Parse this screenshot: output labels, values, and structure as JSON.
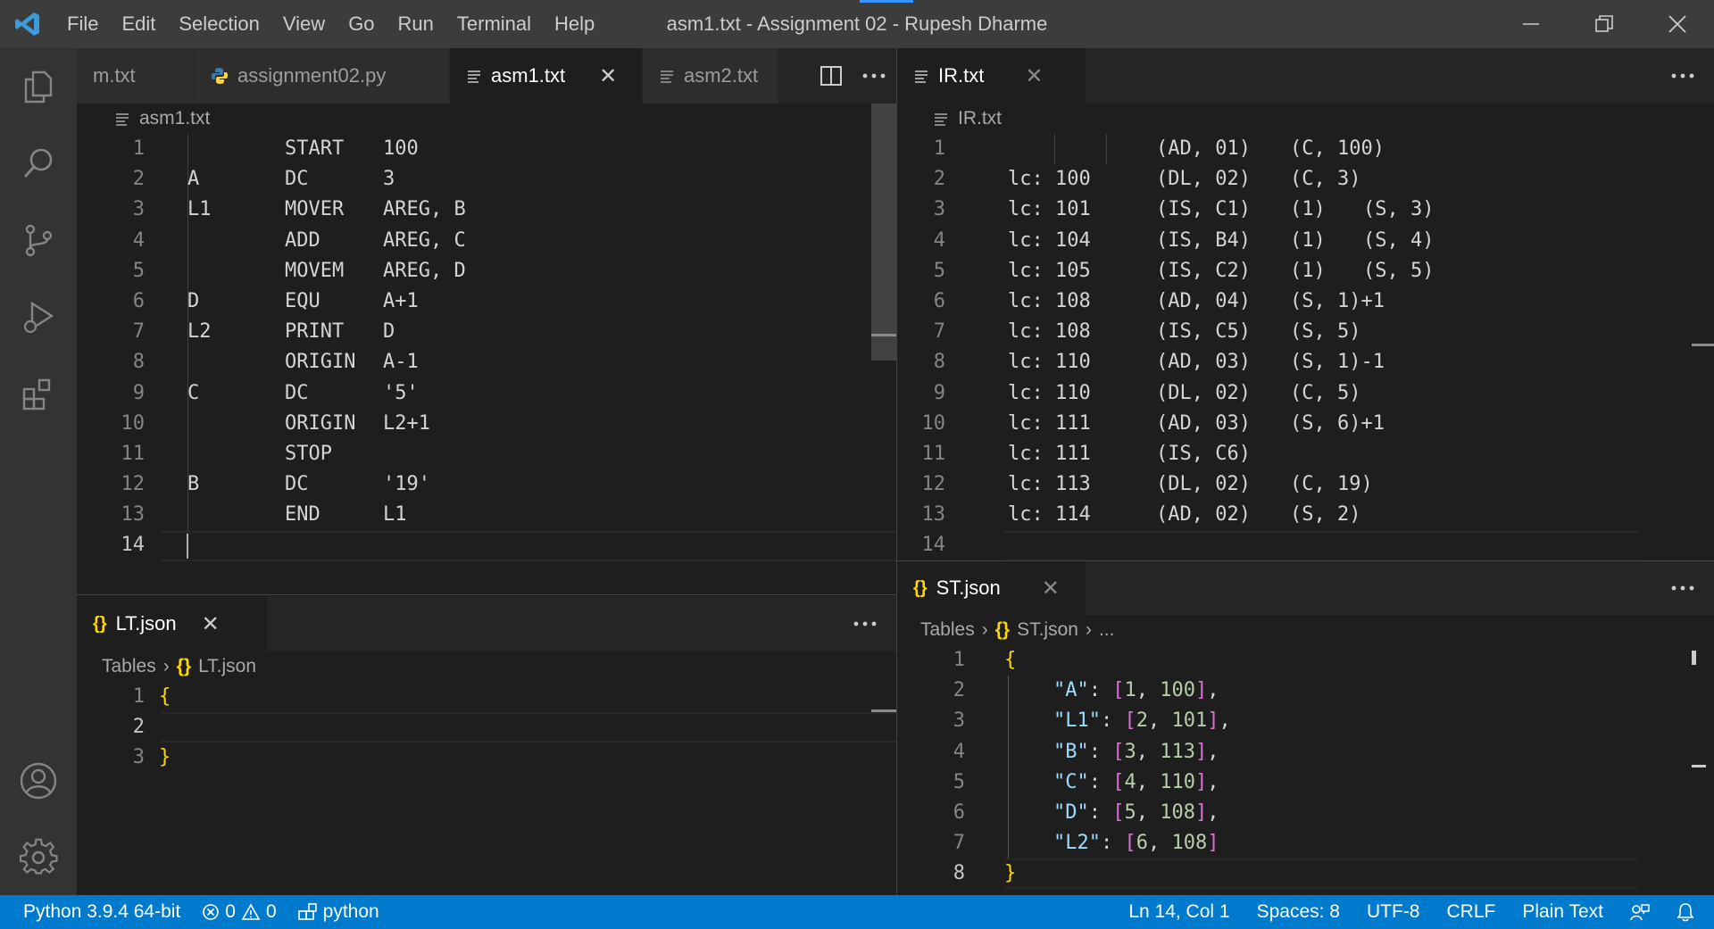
{
  "titlebar": {
    "title": "asm1.txt - Assignment 02 - Rupesh Dharme",
    "menu": [
      "File",
      "Edit",
      "Selection",
      "View",
      "Go",
      "Run",
      "Terminal",
      "Help"
    ]
  },
  "left_top_group": {
    "tabs": [
      {
        "label": "m.txt",
        "icon": "text-file-icon"
      },
      {
        "label": "assignment02.py",
        "icon": "python-icon"
      },
      {
        "label": "asm1.txt",
        "icon": "text-file-icon",
        "active": true
      },
      {
        "label": "asm2.txt",
        "icon": "text-file-icon"
      }
    ],
    "breadcrumb": "asm1.txt",
    "lines": [
      {
        "n": "1",
        "label": "",
        "op": "START",
        "arg": "100"
      },
      {
        "n": "2",
        "label": "A",
        "op": "DC",
        "arg": "3"
      },
      {
        "n": "3",
        "label": "L1",
        "op": "MOVER",
        "arg": "AREG, B"
      },
      {
        "n": "4",
        "label": "",
        "op": "ADD",
        "arg": "AREG, C"
      },
      {
        "n": "5",
        "label": "",
        "op": "MOVEM",
        "arg": "AREG, D"
      },
      {
        "n": "6",
        "label": "D",
        "op": "EQU",
        "arg": "A+1"
      },
      {
        "n": "7",
        "label": "L2",
        "op": "PRINT",
        "arg": "D"
      },
      {
        "n": "8",
        "label": "",
        "op": "ORIGIN",
        "arg": "A-1"
      },
      {
        "n": "9",
        "label": "C",
        "op": "DC",
        "arg": "'5'"
      },
      {
        "n": "10",
        "label": "",
        "op": "ORIGIN",
        "arg": "L2+1"
      },
      {
        "n": "11",
        "label": "",
        "op": "STOP",
        "arg": ""
      },
      {
        "n": "12",
        "label": "B",
        "op": "DC",
        "arg": "'19'"
      },
      {
        "n": "13",
        "label": "",
        "op": "END",
        "arg": "L1"
      },
      {
        "n": "14",
        "label": "",
        "op": "",
        "arg": ""
      }
    ]
  },
  "left_bottom_group": {
    "tab": "LT.json",
    "breadcrumb": {
      "root": "Tables",
      "file": "LT.json"
    },
    "lines": [
      {
        "n": "1",
        "text": "{"
      },
      {
        "n": "2",
        "text": ""
      },
      {
        "n": "3",
        "text": "}"
      }
    ]
  },
  "right_top_group": {
    "tab": "IR.txt",
    "breadcrumb": "IR.txt",
    "lines": [
      {
        "n": "1",
        "lc": "",
        "c1": "(AD, 01)",
        "c2": "(C, 100)",
        "c3": ""
      },
      {
        "n": "2",
        "lc": "lc: 100",
        "c1": "(DL, 02)",
        "c2": "(C, 3)",
        "c3": ""
      },
      {
        "n": "3",
        "lc": "lc: 101",
        "c1": "(IS, C1)",
        "c2": "(1)",
        "c3": "(S, 3)"
      },
      {
        "n": "4",
        "lc": "lc: 104",
        "c1": "(IS, B4)",
        "c2": "(1)",
        "c3": "(S, 4)"
      },
      {
        "n": "5",
        "lc": "lc: 105",
        "c1": "(IS, C2)",
        "c2": "(1)",
        "c3": "(S, 5)"
      },
      {
        "n": "6",
        "lc": "lc: 108",
        "c1": "(AD, 04)",
        "c2": "(S, 1)+1",
        "c3": ""
      },
      {
        "n": "7",
        "lc": "lc: 108",
        "c1": "(IS, C5)",
        "c2": "(S, 5)",
        "c3": ""
      },
      {
        "n": "8",
        "lc": "lc: 110",
        "c1": "(AD, 03)",
        "c2": "(S, 1)-1",
        "c3": ""
      },
      {
        "n": "9",
        "lc": "lc: 110",
        "c1": "(DL, 02)",
        "c2": "(C, 5)",
        "c3": ""
      },
      {
        "n": "10",
        "lc": "lc: 111",
        "c1": "(AD, 03)",
        "c2": "(S, 6)+1",
        "c3": ""
      },
      {
        "n": "11",
        "lc": "lc: 111",
        "c1": "(IS, C6)",
        "c2": "",
        "c3": ""
      },
      {
        "n": "12",
        "lc": "lc: 113",
        "c1": "(DL, 02)",
        "c2": "(C, 19)",
        "c3": ""
      },
      {
        "n": "13",
        "lc": "lc: 114",
        "c1": "(AD, 02)",
        "c2": "(S, 2)",
        "c3": ""
      },
      {
        "n": "14",
        "lc": "",
        "c1": "",
        "c2": "",
        "c3": ""
      }
    ]
  },
  "right_bottom_group": {
    "tab": "ST.json",
    "breadcrumb": {
      "root": "Tables",
      "file": "ST.json",
      "tail": "..."
    },
    "open_brace": "{",
    "close_brace": "}",
    "entries": [
      {
        "key": "\"A\"",
        "a": "1",
        "b": "100",
        "comma": ","
      },
      {
        "key": "\"L1\"",
        "a": "2",
        "b": "101",
        "comma": ","
      },
      {
        "key": "\"B\"",
        "a": "3",
        "b": "113",
        "comma": ","
      },
      {
        "key": "\"C\"",
        "a": "4",
        "b": "110",
        "comma": ","
      },
      {
        "key": "\"D\"",
        "a": "5",
        "b": "108",
        "comma": ","
      },
      {
        "key": "\"L2\"",
        "a": "6",
        "b": "108",
        "comma": ""
      }
    ],
    "line_numbers": [
      "1",
      "2",
      "3",
      "4",
      "5",
      "6",
      "7",
      "8"
    ]
  },
  "statusbar": {
    "python": "Python 3.9.4 64-bit",
    "errors": "0",
    "warnings": "0",
    "env": "python",
    "position": "Ln 14, Col 1",
    "spaces": "Spaces: 8",
    "encoding": "UTF-8",
    "eol": "CRLF",
    "language": "Plain Text"
  },
  "colors": {
    "accent": "#007acc",
    "json_key": "#9cdcfe",
    "json_number": "#b5cea8",
    "json_brace": "#ffd700",
    "json_bracket": "#da70d6"
  }
}
